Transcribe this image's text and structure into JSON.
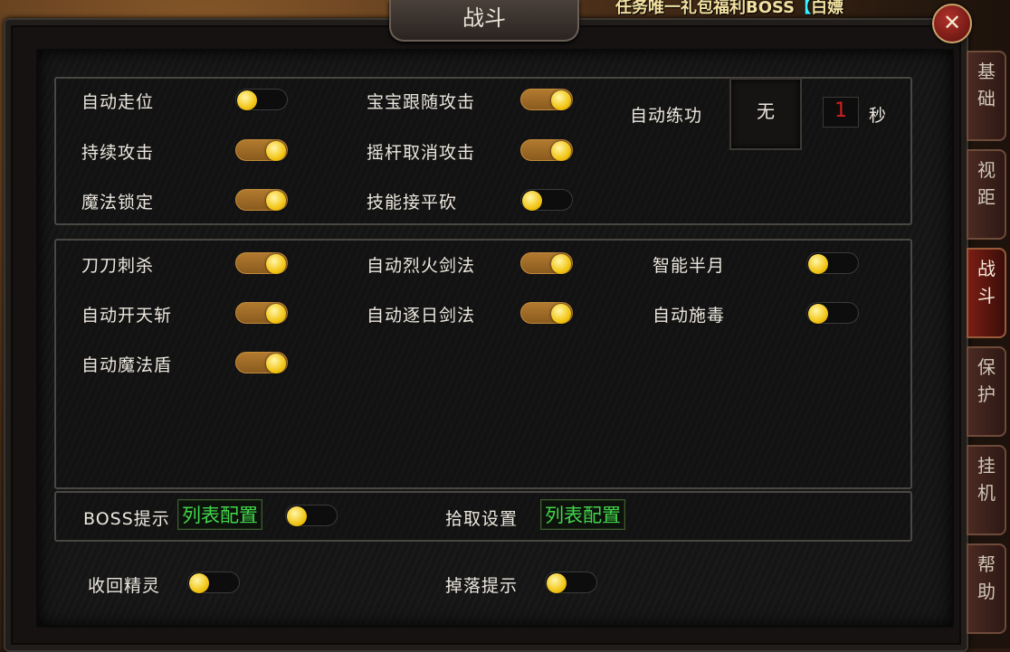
{
  "window": {
    "title": "战斗"
  },
  "banner": {
    "text": "任务唯一礼包福利BOSS",
    "bracket": "【",
    "tail": "白嫖"
  },
  "close_icon": "close-icon",
  "tabs": [
    {
      "label": "基础",
      "chars": [
        "基",
        "础"
      ],
      "active": false
    },
    {
      "label": "视距",
      "chars": [
        "视",
        "距"
      ],
      "active": false
    },
    {
      "label": "战斗",
      "chars": [
        "战",
        "斗"
      ],
      "active": true
    },
    {
      "label": "保护",
      "chars": [
        "保",
        "护"
      ],
      "active": false
    },
    {
      "label": "挂机",
      "chars": [
        "挂",
        "机"
      ],
      "active": false
    },
    {
      "label": "帮助",
      "chars": [
        "帮",
        "助"
      ],
      "active": false
    }
  ],
  "section1": {
    "auto_move": {
      "label": "自动走位",
      "on": false
    },
    "continuous_attack": {
      "label": "持续攻击",
      "on": true
    },
    "magic_lock": {
      "label": "魔法锁定",
      "on": true
    },
    "pet_follow": {
      "label": "宝宝跟随攻击",
      "on": true
    },
    "joystick_cancel": {
      "label": "摇杆取消攻击",
      "on": true
    },
    "skill_flat": {
      "label": "技能接平砍",
      "on": false
    },
    "auto_practice": {
      "label": "自动练功",
      "slot": "无",
      "value": "1",
      "unit": "秒"
    }
  },
  "section2": {
    "col1": [
      {
        "label": "刀刀刺杀",
        "on": true
      },
      {
        "label": "自动开天斩",
        "on": true
      },
      {
        "label": "自动魔法盾",
        "on": true
      }
    ],
    "col2": [
      {
        "label": "自动烈火剑法",
        "on": true
      },
      {
        "label": "自动逐日剑法",
        "on": true
      }
    ],
    "col3": [
      {
        "label": "智能半月",
        "on": false
      },
      {
        "label": "自动施毒",
        "on": false
      }
    ]
  },
  "section3": {
    "boss_tip": {
      "label": "BOSS提示",
      "button": "列表配置",
      "on": false
    },
    "loot": {
      "label": "拾取设置",
      "button": "列表配置"
    }
  },
  "bottom": {
    "recall": {
      "label": "收回精灵",
      "on": false
    },
    "drop_tip": {
      "label": "掉落提示",
      "on": false
    }
  },
  "colors": {
    "toggle_on": "#b27a2f",
    "toggle_off": "#0d0d0d",
    "knob": "#f2c515",
    "config_text": "#3fd84a",
    "counter_text": "#d11f1f"
  }
}
